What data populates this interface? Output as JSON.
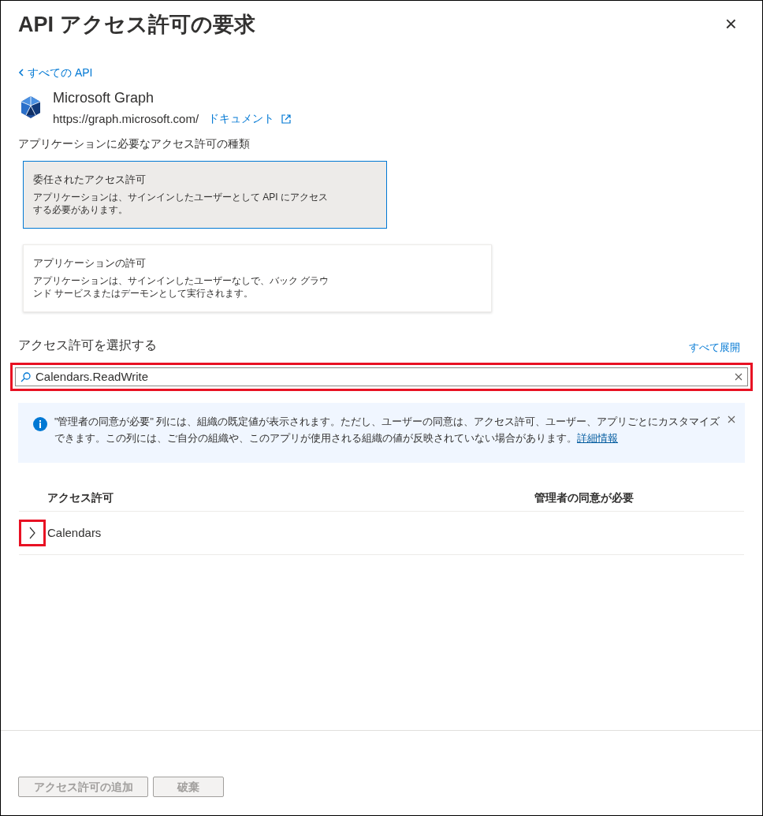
{
  "panel": {
    "title": "API アクセス許可の要求",
    "close": "×"
  },
  "back_link": "すべての API",
  "api": {
    "name": "Microsoft Graph",
    "url": "https://graph.microsoft.com/",
    "docs_link": "ドキュメント"
  },
  "type_question": "アプリケーションに必要なアクセス許可の種類",
  "permission_types": [
    {
      "title": "委任されたアクセス許可",
      "description": "アプリケーションは、サインインしたユーザーとして API にアクセスする必要があります。",
      "selected": true
    },
    {
      "title": "アプリケーションの許可",
      "description": "アプリケーションは、サインインしたユーザーなしで、バック グラウンド サービスまたはデーモンとして実行されます。",
      "selected": false
    }
  ],
  "select_section": {
    "title": "アクセス許可を選択する",
    "expand_all": "すべて展開"
  },
  "search": {
    "value": "Calendars.ReadWrite",
    "highlighted": true
  },
  "info_banner": {
    "text": "\"管理者の同意が必要\" 列には、組織の既定値が表示されます。ただし、ユーザーの同意は、アクセス許可、ユーザー、アプリごとにカスタマイズできます。この列には、ご自分の組織や、このアプリが使用される組織の値が反映されていない場合があります。",
    "link": "詳細情報"
  },
  "table": {
    "columns": [
      "アクセス許可",
      "管理者の同意が必要"
    ],
    "rows": [
      {
        "name": "Calendars",
        "expanded": false,
        "highlighted": true
      }
    ]
  },
  "buttons": [
    {
      "label": "アクセス許可の追加",
      "disabled": true
    },
    {
      "label": "破棄",
      "disabled": true
    }
  ]
}
